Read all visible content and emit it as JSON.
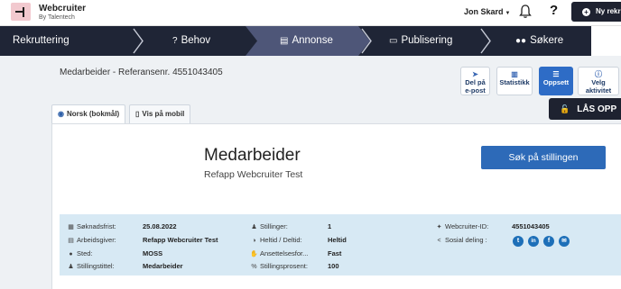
{
  "header": {
    "brand_name": "Webcruiter",
    "brand_sub": "By Talentech",
    "user_name": "Jon Skard",
    "help_glyph": "?",
    "new_button_label": "Ny rekr"
  },
  "steps": [
    {
      "label": "Rekruttering",
      "icon": "none"
    },
    {
      "label": "Behov",
      "icon": "question-icon",
      "glyph": "?"
    },
    {
      "label": "Annonse",
      "icon": "document-icon",
      "glyph": "▤"
    },
    {
      "label": "Publisering",
      "icon": "monitor-icon",
      "glyph": "▭"
    },
    {
      "label": "Søkere",
      "icon": "users-icon",
      "glyph": "👥"
    }
  ],
  "active_step": "Annonse",
  "page": {
    "reference_title": "Medarbeider - Referansenr. 4551043405"
  },
  "actions": [
    {
      "line1": "Del på",
      "line2": "e-post",
      "icon": "send-icon"
    },
    {
      "line1": "Statistikk",
      "line2": "",
      "icon": "chart-icon"
    },
    {
      "line1": "Oppsett",
      "line2": "",
      "icon": "settings-icon"
    },
    {
      "line1": "Velg",
      "line2": "aktivitet",
      "icon": "info-icon"
    }
  ],
  "lock_button": "LÅS OPP",
  "tabs": [
    {
      "label": "Norsk (bokmål)",
      "icon": "globe-icon"
    },
    {
      "label": "Vis på mobil",
      "icon": "mobile-icon"
    }
  ],
  "job": {
    "title": "Medarbeider",
    "company": "Refapp Webcruiter Test",
    "apply_label": "Søk på stillingen"
  },
  "info": {
    "col1": [
      {
        "label": "Søknadsfrist:",
        "value": "25.08.2022",
        "icon": "calendar-icon"
      },
      {
        "label": "Arbeidsgiver:",
        "value": "Refapp Webcruiter Test",
        "icon": "building-icon"
      },
      {
        "label": "Sted:",
        "value": "MOSS",
        "icon": "location-icon"
      },
      {
        "label": "Stillingstittel:",
        "value": "Medarbeider",
        "icon": "person-icon"
      }
    ],
    "col2": [
      {
        "label": "Stillinger:",
        "value": "1",
        "icon": "people-icon"
      },
      {
        "label": "Heltid / Deltid:",
        "value": "Heltid",
        "icon": "half-circle-icon"
      },
      {
        "label": "Ansettelsesfor...",
        "value": "Fast",
        "icon": "handshake-icon"
      },
      {
        "label": "Stillingsprosent:",
        "value": "100",
        "icon": "percent-icon"
      }
    ],
    "col3": [
      {
        "label": "Webcruiter-ID:",
        "value": "4551043405",
        "icon": "pin-icon"
      },
      {
        "label": "Sosial deling :",
        "value": "",
        "icon": "share-icon"
      }
    ],
    "social": [
      {
        "name": "twitter",
        "glyph": "t"
      },
      {
        "name": "linkedin",
        "glyph": "in"
      },
      {
        "name": "facebook",
        "glyph": "f"
      },
      {
        "name": "email",
        "glyph": "✉"
      }
    ]
  },
  "colors": {
    "nav_bg": "#1f2536",
    "nav_active": "#4e5678",
    "primary": "#2d6ab8",
    "info_bg": "#d7e9f4",
    "logo_bg": "#f2c9cf"
  }
}
